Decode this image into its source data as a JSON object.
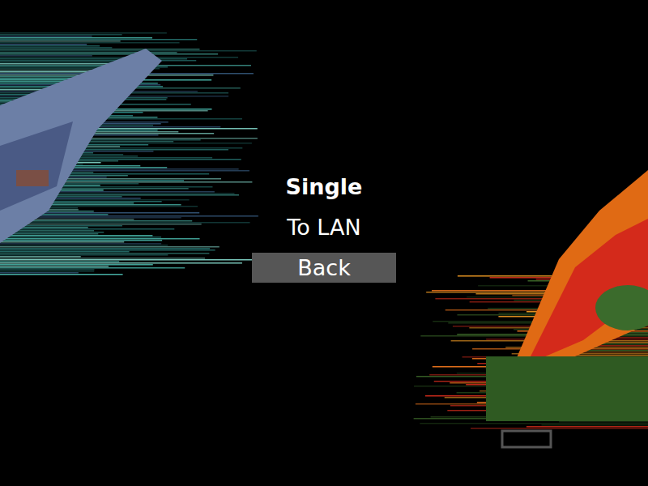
{
  "menu": {
    "items": [
      {
        "label": "Single",
        "selected": false,
        "emphasized": true
      },
      {
        "label": "To LAN",
        "selected": false,
        "emphasized": false
      },
      {
        "label": "Back",
        "selected": true,
        "emphasized": false
      }
    ]
  }
}
